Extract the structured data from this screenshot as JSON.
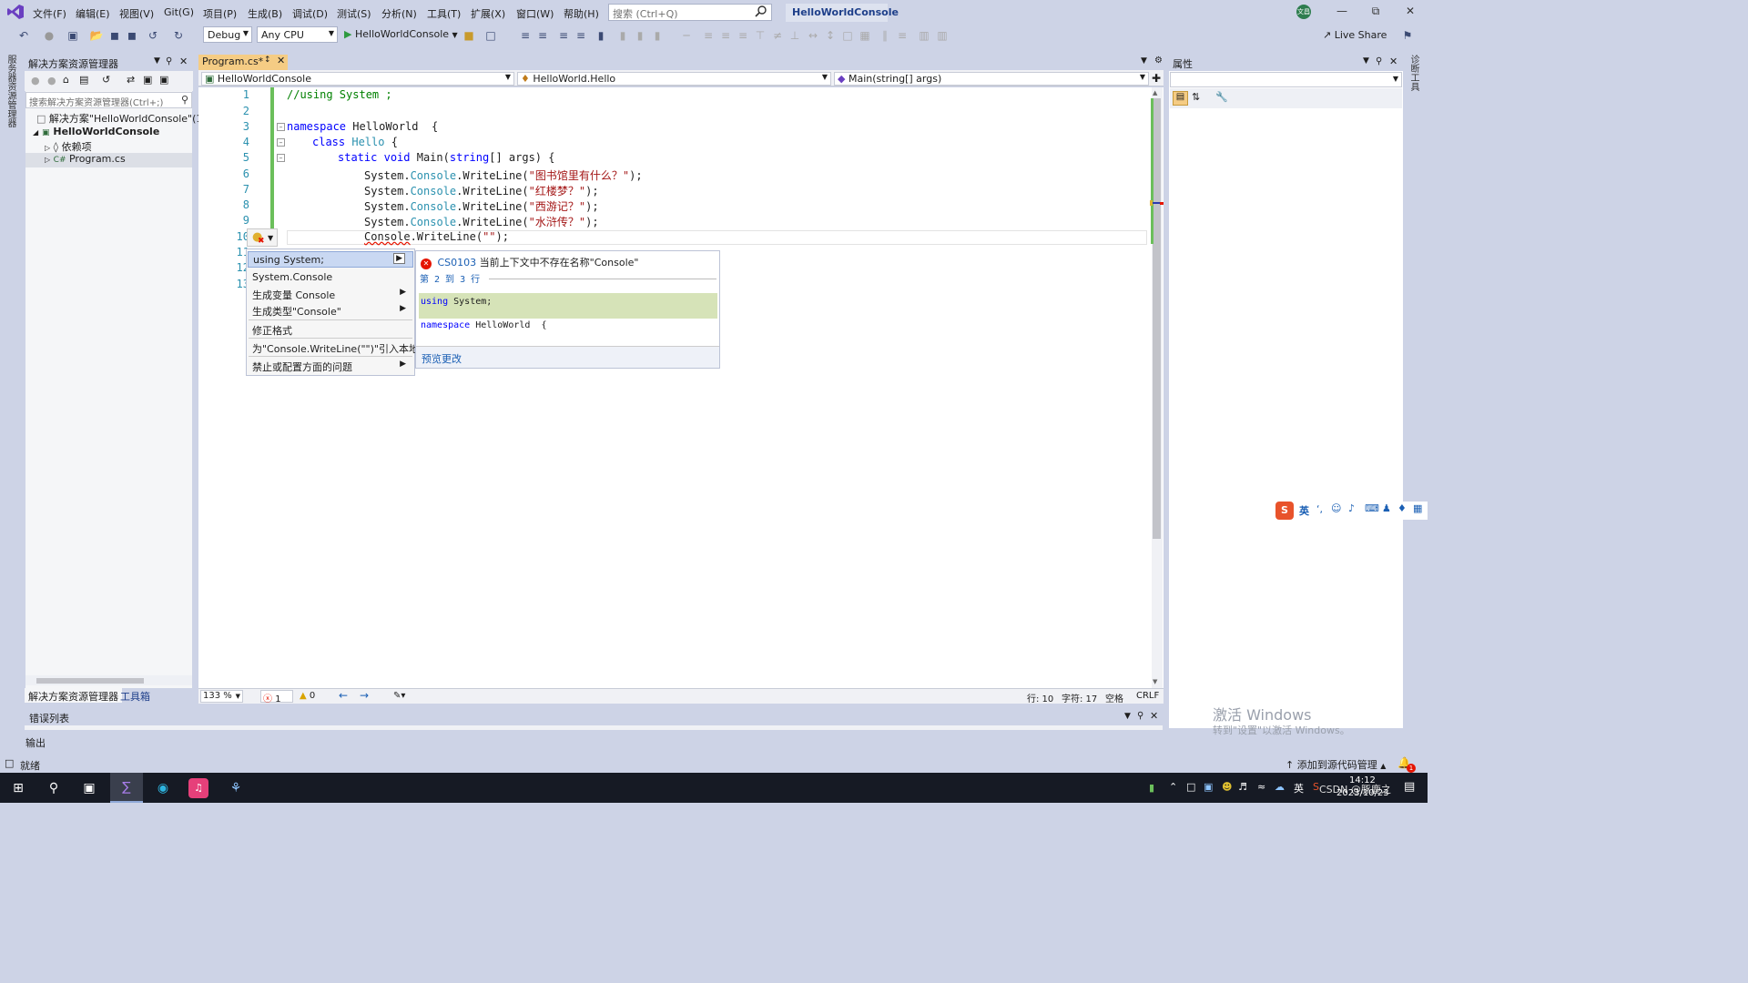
{
  "menubar": {
    "items": [
      "文件(F)",
      "编辑(E)",
      "视图(V)",
      "Git(G)",
      "项目(P)",
      "生成(B)",
      "调试(D)",
      "测试(S)",
      "分析(N)",
      "工具(T)",
      "扩展(X)",
      "窗口(W)",
      "帮助(H)"
    ],
    "search_placeholder": "搜索 (Ctrl+Q)",
    "solution_title": "HelloWorldConsole",
    "avatar_text": "文昌"
  },
  "toolbar": {
    "config": "Debug",
    "platform": "Any CPU",
    "run_target": "HelloWorldConsole",
    "live_share": "Live Share"
  },
  "left_strip": {
    "label": "服务器资源管理器"
  },
  "right_strip": {
    "label": "诊断工具"
  },
  "solution_explorer": {
    "title": "解决方案资源管理器",
    "search_placeholder": "搜索解决方案资源管理器(Ctrl+;)",
    "tree": [
      {
        "label": "解决方案\"HelloWorldConsole\"(1"
      },
      {
        "label": "HelloWorldConsole"
      },
      {
        "label": "依赖项"
      },
      {
        "label": "Program.cs"
      }
    ],
    "tabs": [
      "解决方案资源管理器",
      "工具箱"
    ]
  },
  "editor": {
    "tab_label": "Program.cs*",
    "nav_project": "HelloWorldConsole",
    "nav_class": "HelloWorld.Hello",
    "nav_member": "Main(string[] args)",
    "line_numbers": [
      "1",
      "2",
      "3",
      "4",
      "5",
      "6",
      "7",
      "8",
      "9",
      "10",
      "11",
      "12",
      "13"
    ],
    "code": {
      "l1_comment": "//using System ;",
      "l3_kw": "namespace",
      "l3_rest": " HelloWorld  {",
      "l4_kw": "class",
      "l4_type": "Hello",
      "l4_rest": " {",
      "l5_kw1": "static",
      "l5_kw2": "void",
      "l5_name": "Main",
      "l5_kw3": "string",
      "l5_rest": "[] args) {",
      "sys": "System.",
      "console": "Console",
      "writeline": ".WriteLine(",
      "l6_str": "\"图书馆里有什么？\"",
      "l7_str": "\"红楼梦？\"",
      "l8_str": "\"西游记？\"",
      "l9_str": "\"水浒传？\"",
      "l10_str": "\"\"",
      "end": ");"
    },
    "status": {
      "zoom": "133 %",
      "errors": "1",
      "warnings": "0",
      "line": "行: 10",
      "char": "字符: 17",
      "space": "空格",
      "eol": "CRLF"
    }
  },
  "quick_actions": {
    "items": [
      "using System;",
      "System.Console",
      "生成变量 Console",
      "生成类型\"Console\"",
      "修正格式",
      "为\"Console.WriteLine(\"\")\"引入本地",
      "禁止或配置方面的问题"
    ],
    "preview": {
      "error_code": "CS0103",
      "error_msg": "当前上下文中不存在名称\"Console\"",
      "lines_note": "第 2 到 3 行",
      "added_kw": "using",
      "added_rest": " System;",
      "ns_kw": "namespace",
      "ns_rest": " HelloWorld  {",
      "preview_link": "预览更改"
    }
  },
  "properties": {
    "title": "属性"
  },
  "watermark": {
    "line1": "激活 Windows",
    "line2": "转到\"设置\"以激活 Windows。"
  },
  "bottom": {
    "error_list": "错误列表",
    "output": "输出"
  },
  "statusbar": {
    "ready": "就绪",
    "source_control": "添加到源代码管理",
    "notification_count": "1"
  },
  "taskbar": {
    "ime": "英",
    "time": "14:12",
    "date": "2023/10/23",
    "csdn": "CSDN @",
    "author": "豚鹿之"
  }
}
